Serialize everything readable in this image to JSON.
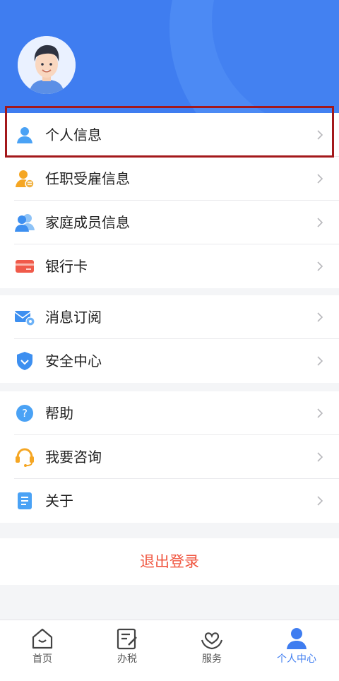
{
  "profile": {
    "avatar_icon": "avatar"
  },
  "menu": {
    "group1": [
      {
        "id": "personal-info",
        "label": "个人信息",
        "icon": "person-icon"
      },
      {
        "id": "employment-info",
        "label": "任职受雇信息",
        "icon": "employment-icon"
      },
      {
        "id": "family-info",
        "label": "家庭成员信息",
        "icon": "family-icon"
      },
      {
        "id": "bank-card",
        "label": "银行卡",
        "icon": "bank-card-icon"
      }
    ],
    "group2": [
      {
        "id": "message-subscription",
        "label": "消息订阅",
        "icon": "mail-icon"
      },
      {
        "id": "security-center",
        "label": "安全中心",
        "icon": "shield-icon"
      }
    ],
    "group3": [
      {
        "id": "help",
        "label": "帮助",
        "icon": "help-icon"
      },
      {
        "id": "consult",
        "label": "我要咨询",
        "icon": "headset-icon"
      },
      {
        "id": "about",
        "label": "关于",
        "icon": "document-icon"
      }
    ]
  },
  "logout_label": "退出登录",
  "tabs": [
    {
      "label": "首页",
      "icon": "home-icon",
      "active": false
    },
    {
      "label": "办税",
      "icon": "tax-form-icon",
      "active": false
    },
    {
      "label": "服务",
      "icon": "heart-hands-icon",
      "active": false
    },
    {
      "label": "个人中心",
      "icon": "user-center-icon",
      "active": true
    }
  ],
  "colors": {
    "primary": "#3f7df0",
    "logout": "#f0553f",
    "highlight": "#a3181b"
  }
}
